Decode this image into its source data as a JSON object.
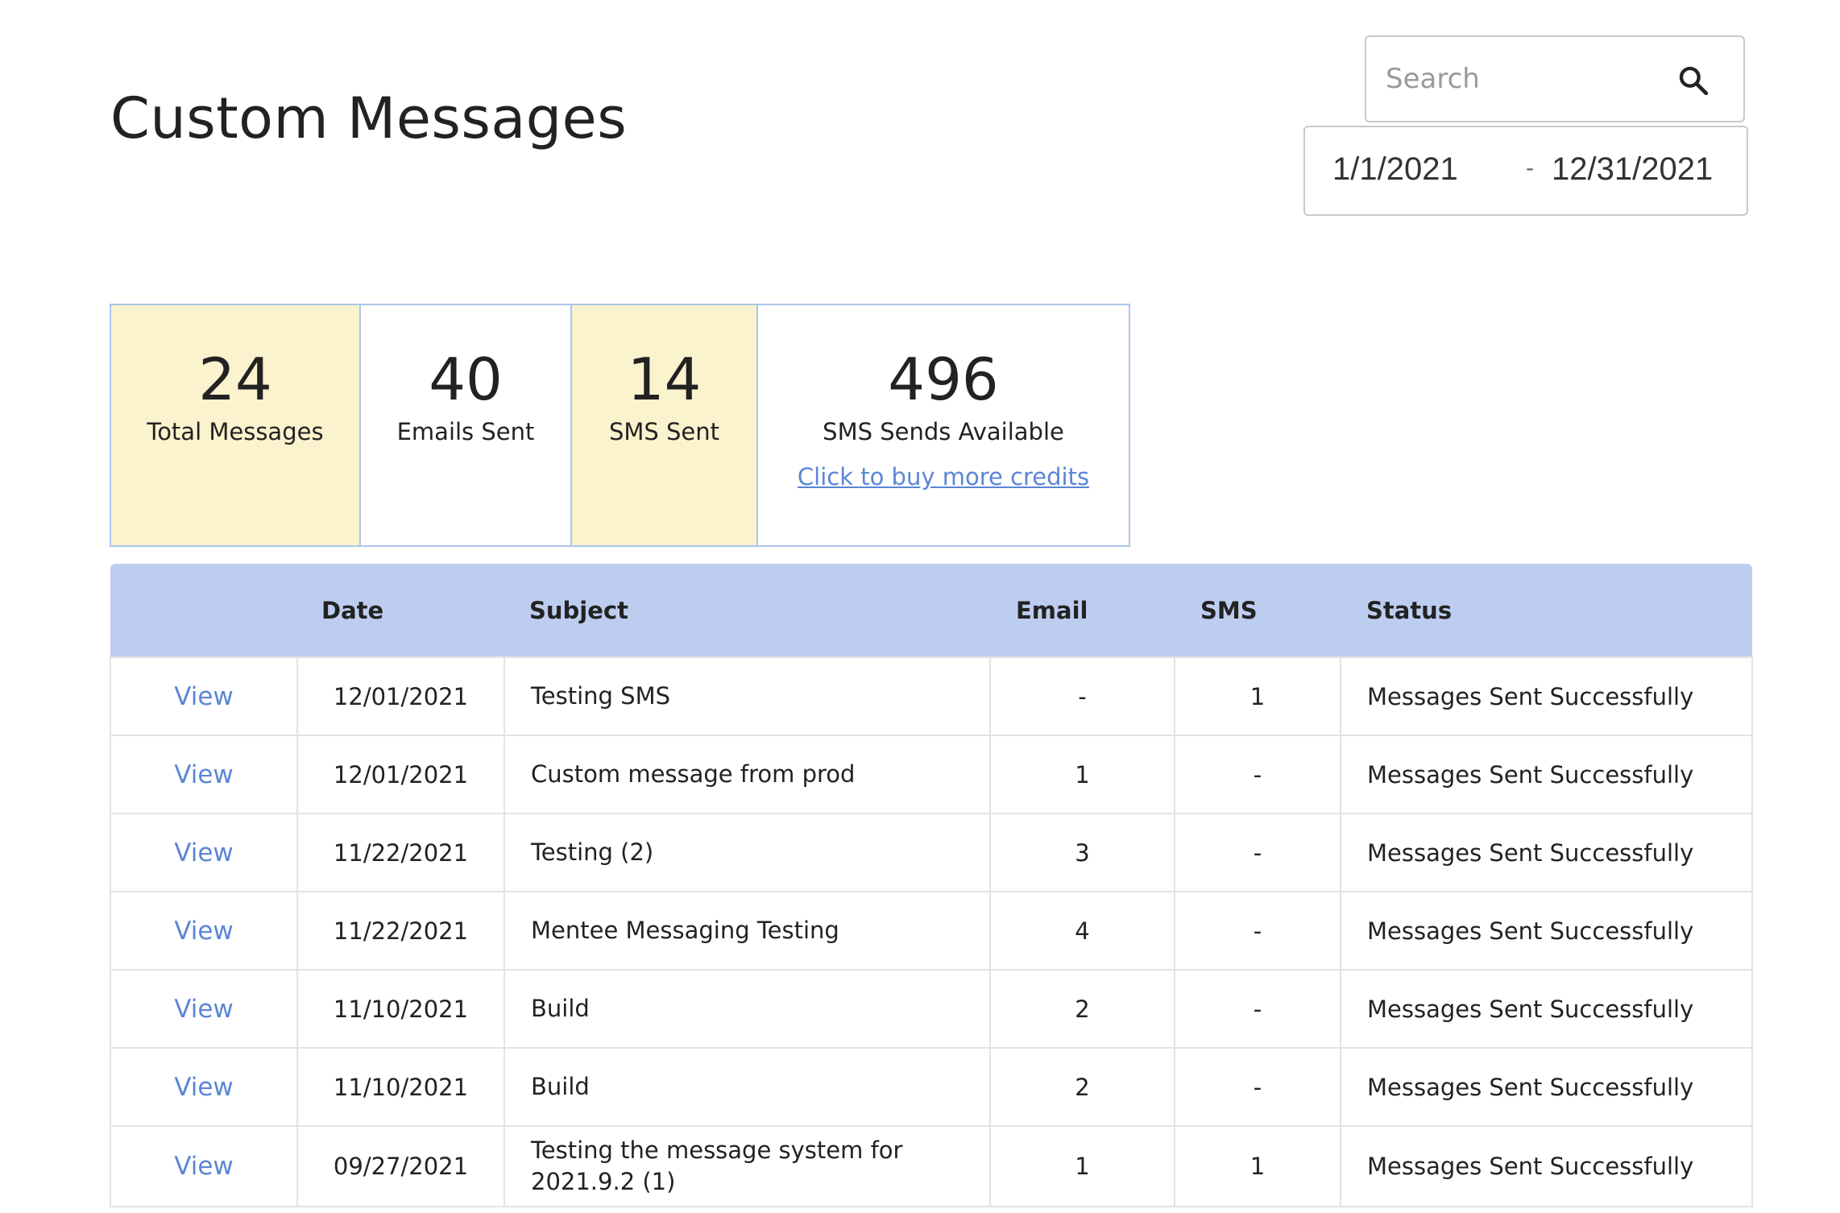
{
  "page": {
    "title": "Custom Messages"
  },
  "search": {
    "placeholder": "Search",
    "icon": "search-icon"
  },
  "date_range": {
    "start": "1/1/2021",
    "separator": "-",
    "end": "12/31/2021"
  },
  "stats": {
    "total_messages": {
      "value": "24",
      "label": "Total Messages"
    },
    "emails_sent": {
      "value": "40",
      "label": "Emails Sent"
    },
    "sms_sent": {
      "value": "14",
      "label": "SMS Sent"
    },
    "sms_available": {
      "value": "496",
      "label": "SMS Sends Available",
      "link": "Click to buy more credits"
    },
    "highlight_color": "#fbf2ce",
    "border_color": "#a9c7ea"
  },
  "table": {
    "header_color": "#bdcdf0",
    "columns": {
      "view": "",
      "date": "Date",
      "subject": "Subject",
      "email": "Email",
      "sms": "SMS",
      "status": "Status"
    },
    "rows": [
      {
        "action": "View",
        "date": "12/01/2021",
        "subject": "Testing SMS",
        "email": "-",
        "sms": "1",
        "status": "Messages Sent Successfully"
      },
      {
        "action": "View",
        "date": "12/01/2021",
        "subject": "Custom message from prod",
        "email": "1",
        "sms": "-",
        "status": "Messages Sent Successfully"
      },
      {
        "action": "View",
        "date": "11/22/2021",
        "subject": "Testing (2)",
        "email": "3",
        "sms": "-",
        "status": "Messages Sent Successfully"
      },
      {
        "action": "View",
        "date": "11/22/2021",
        "subject": "Mentee Messaging Testing",
        "email": "4",
        "sms": "-",
        "status": "Messages Sent Successfully"
      },
      {
        "action": "View",
        "date": "11/10/2021",
        "subject": "Build",
        "email": "2",
        "sms": "-",
        "status": "Messages Sent Successfully"
      },
      {
        "action": "View",
        "date": "11/10/2021",
        "subject": "Build",
        "email": "2",
        "sms": "-",
        "status": "Messages Sent Successfully"
      },
      {
        "action": "View",
        "date": "09/27/2021",
        "subject": "Testing the message system for 2021.9.2 (1)",
        "email": "1",
        "sms": "1",
        "status": "Messages Sent Successfully"
      }
    ]
  },
  "colors": {
    "link": "#5b86d6"
  }
}
